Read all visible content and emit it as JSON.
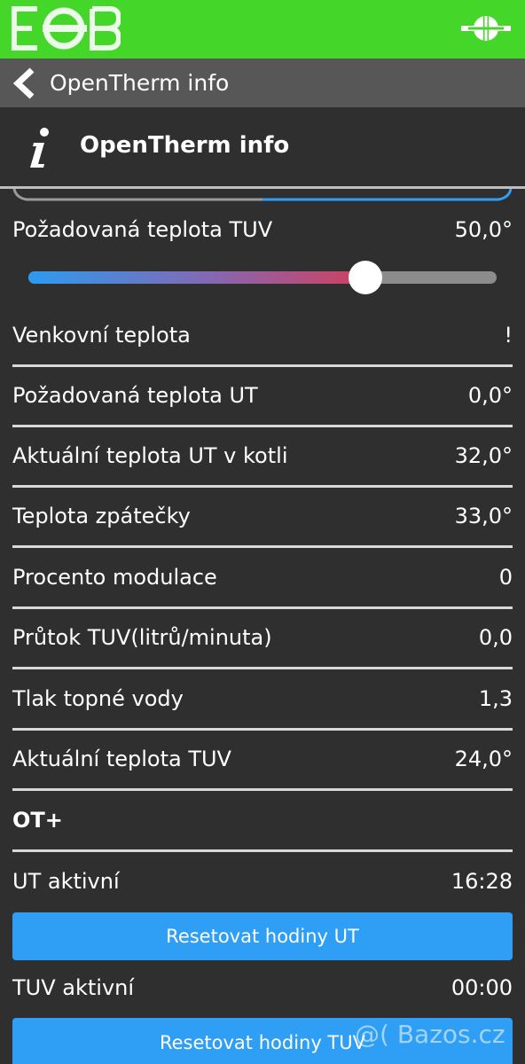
{
  "header": {
    "brand_colors": {
      "bar": "#45d62a",
      "button": "#2f9ef5"
    }
  },
  "nav": {
    "title": "OpenTherm info"
  },
  "page": {
    "title": "OpenTherm info"
  },
  "dhw_setpoint": {
    "label": "Požadovaná teplota TUV",
    "value": "50,0°",
    "slider_fraction": 0.72
  },
  "rows": [
    {
      "label": "Venkovní teplota",
      "value": "!"
    },
    {
      "label": "Požadovaná teplota UT",
      "value": "0,0°"
    },
    {
      "label": "Aktuální teplota UT v kotli",
      "value": "32,0°"
    },
    {
      "label": "Teplota zpátečky",
      "value": "33,0°"
    },
    {
      "label": "Procento modulace",
      "value": "0"
    },
    {
      "label": "Průtok TUV(litrů/minuta)",
      "value": "0,0"
    },
    {
      "label": "Tlak topné vody",
      "value": "1,3"
    },
    {
      "label": "Aktuální teplota TUV",
      "value": "24,0°"
    }
  ],
  "ot_plus": {
    "label": "OT+"
  },
  "ut_active": {
    "label": "UT aktivní",
    "value": "16:28",
    "reset_label": "Resetovat hodiny UT"
  },
  "tuv_active": {
    "label": "TUV aktivní",
    "value": "00:00",
    "reset_label": "Resetovat hodiny TUV"
  },
  "watermark": "@( Bazos.cz"
}
